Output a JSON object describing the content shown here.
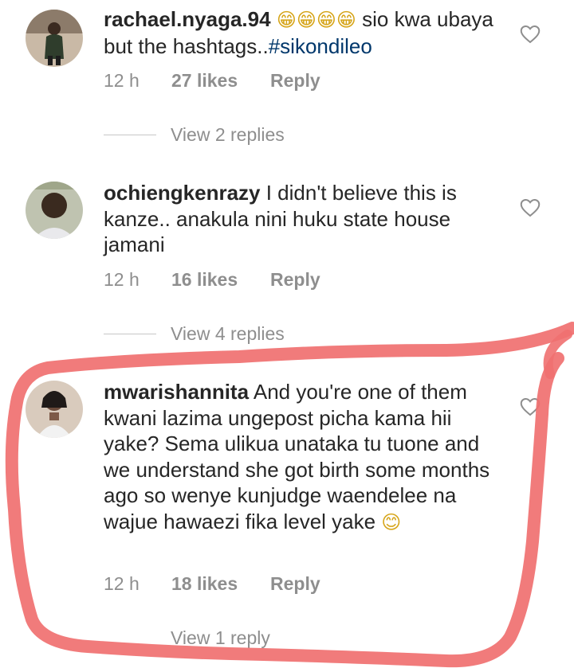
{
  "comments": [
    {
      "username": "rachael.nyaga.94",
      "emoji": "😁😁😁😁",
      "text_before": " sio kwa ubaya but the hashtags..",
      "hashtag": "#sikondileo",
      "time": "12 h",
      "likes": "27 likes",
      "reply": "Reply",
      "view_replies": "View 2 replies"
    },
    {
      "username": "ochiengkenrazy",
      "text": " I didn't believe this is kanze.. anakula nini huku state house jamani",
      "time": "12 h",
      "likes": "16 likes",
      "reply": "Reply",
      "view_replies": "View 4 replies"
    },
    {
      "username": "mwarishannita",
      "text": " And you're one of them kwani lazima ungepost picha kama hii yake? Sema ulikua unataka tu tuone and we understand she got birth some months ago so wenye kunjudge waendelee na wajue hawaezi fika level yake ",
      "emoji": "😊",
      "time": "12 h",
      "likes": "18 likes",
      "reply": "Reply",
      "view_replies": "View 1 reply"
    }
  ],
  "colors": {
    "text": "#262626",
    "meta": "#8e8e8e",
    "hashtag": "#00376b",
    "highlight": "#f07070"
  }
}
